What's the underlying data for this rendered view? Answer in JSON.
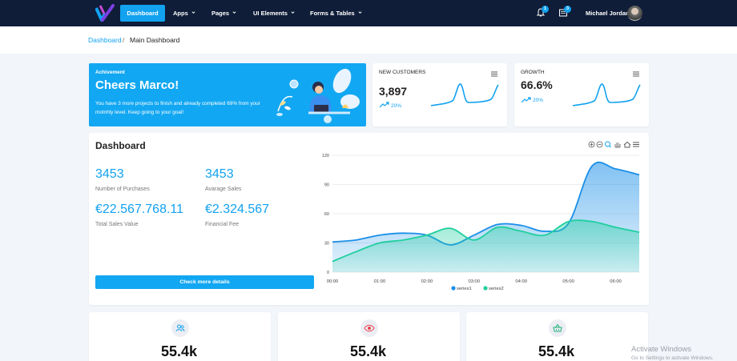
{
  "nav": {
    "items": [
      {
        "label": "Dashboard",
        "active": true
      },
      {
        "label": "Apps"
      },
      {
        "label": "Pages"
      },
      {
        "label": "UI Elements"
      },
      {
        "label": "Forms & Tables"
      }
    ],
    "notifications_count": "1",
    "messages_count": "3",
    "user_name": "Michael Jordan"
  },
  "breadcrumb": {
    "root": "Dashboard",
    "separator": "/",
    "current": "Main Dashboard"
  },
  "hero": {
    "kicker": "Achivement",
    "title": "Cheers Marco!",
    "text": "You have 3 more projects to finish and already completed 69% from your motnhly level. Keep going to your goal!"
  },
  "stats": [
    {
      "label": "NEW CUSTOMERS",
      "value": "3,897",
      "change": "20%"
    },
    {
      "label": "GROWTH",
      "value": "66.6%",
      "change": "20%"
    }
  ],
  "dashboard": {
    "title": "Dashboard",
    "metrics": [
      {
        "value": "3453",
        "label": "Number of Purchases"
      },
      {
        "value": "3453",
        "label": "Avarage Sales"
      },
      {
        "value": "€22.567.768.11",
        "label": "Total Sales Value"
      },
      {
        "value": "€2.324.567",
        "label": "Financial Fee"
      }
    ],
    "cta": "Check more details"
  },
  "chart_data": {
    "type": "area",
    "x": [
      "00:00",
      "01:00",
      "02:00",
      "03:00",
      "04:00",
      "05:00",
      "06:00"
    ],
    "series": [
      {
        "name": "series1",
        "color": "#1a8fe8",
        "x": [
          0,
          0.5,
          1.0,
          1.5,
          2.0,
          2.5,
          3.0,
          3.5,
          4.0,
          4.5,
          5.0,
          5.5,
          6.0,
          6.5
        ],
        "values": [
          31,
          33,
          38,
          40,
          38,
          28,
          38,
          49,
          48,
          42,
          50,
          109,
          106,
          100
        ]
      },
      {
        "name": "series2",
        "color": "#1fcf9e",
        "x": [
          0,
          0.5,
          1.0,
          1.5,
          2.0,
          2.5,
          3.0,
          3.5,
          4.0,
          4.5,
          5.0,
          5.5,
          6.0,
          6.5
        ],
        "values": [
          11,
          21,
          30,
          33,
          38,
          45,
          33,
          46,
          42,
          38,
          52,
          52,
          46,
          41
        ]
      }
    ],
    "yticks": [
      0,
      30,
      60,
      90,
      120
    ],
    "ylim": [
      0,
      120
    ],
    "legend": "bottom-center",
    "grid": true
  },
  "bottom_cards": [
    {
      "icon": "users-icon",
      "value": "55.4k",
      "color": "#12a2f0"
    },
    {
      "icon": "eye-icon",
      "value": "55.4k",
      "color": "#e8434d"
    },
    {
      "icon": "basket-icon",
      "value": "55.4k",
      "color": "#1fb079"
    }
  ],
  "watermark": {
    "title": "Activate Windows",
    "subtitle": "Go to Settings to activate Windows."
  }
}
